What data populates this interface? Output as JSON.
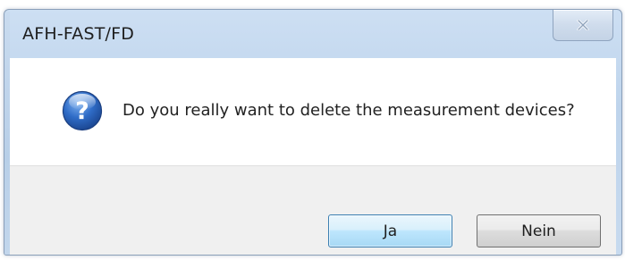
{
  "window": {
    "title": "AFH-FAST/FD",
    "close_symbol": "x"
  },
  "message": {
    "icon": "question-icon",
    "text": "Do you really want to delete the measurement devices?"
  },
  "buttons": {
    "yes_label": "Ja",
    "no_label": "Nein"
  },
  "colors": {
    "titlebar": "#c7daef",
    "icon_blue": "#2a5fb0",
    "default_button_border": "#3c7fb1"
  }
}
